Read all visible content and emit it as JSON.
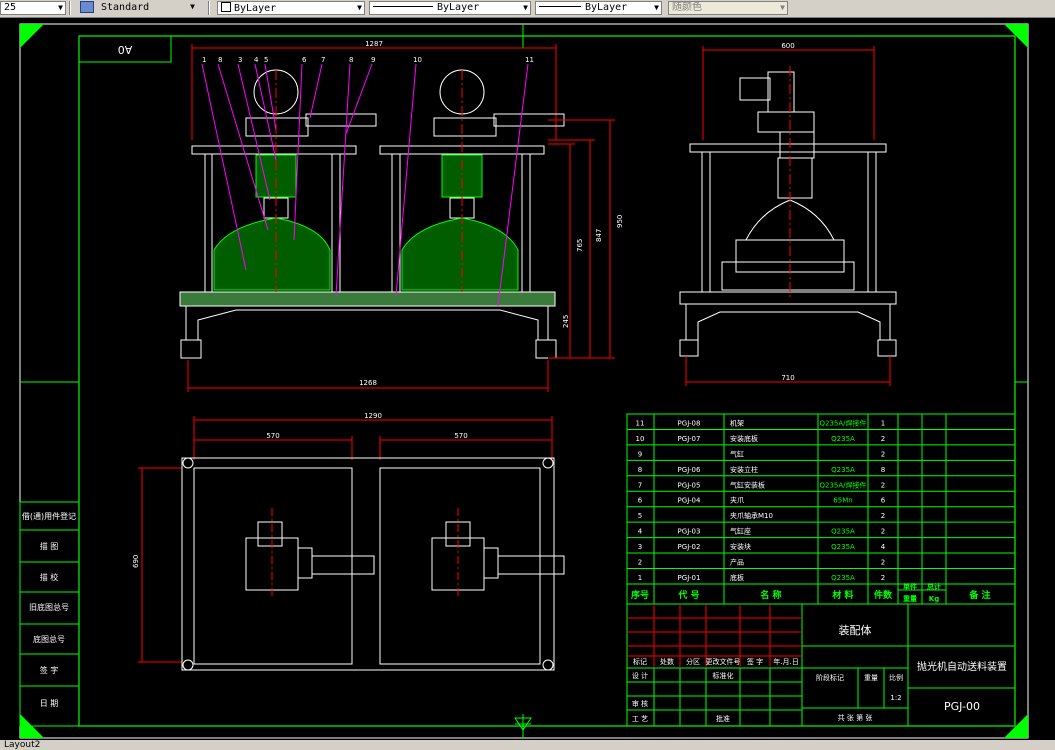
{
  "toolbar": {
    "size_value": "25",
    "text_style": "Standard",
    "layer_color": "ByLayer",
    "linetype": "ByLayer",
    "lineweight": "ByLayer",
    "plot_style": "随颜色"
  },
  "sheet": {
    "size_label": "A0",
    "overall_length": "1287"
  },
  "front_view": {
    "balloons": [
      "1",
      "8",
      "3",
      "4",
      "5",
      "6",
      "7",
      "8",
      "9",
      "10",
      "11"
    ],
    "dim_heights": [
      "765",
      "847",
      "950",
      "245"
    ],
    "dim_base_length": "1268"
  },
  "side_view": {
    "dim_top": "600",
    "dim_bottom": "710"
  },
  "plan_view": {
    "dim_total": "1290",
    "dim_left": "570",
    "dim_right": "570",
    "dim_depth": "690"
  },
  "left_margin": {
    "cells": [
      "借(通)用件登记",
      "描 图",
      "描 校",
      "旧底图总号",
      "底图总号",
      "签 字",
      "日 期"
    ]
  },
  "bom": {
    "header": [
      "序号",
      "代 号",
      "名 称",
      "材 料",
      "件数",
      "单件",
      "总计",
      "备 注"
    ],
    "header_sub": [
      "重量",
      "Kg"
    ],
    "rows": [
      {
        "no": "11",
        "code": "PGJ-08",
        "name": "机架",
        "material": "Q235A/焊接件",
        "qty": "1"
      },
      {
        "no": "10",
        "code": "PGJ-07",
        "name": "安装底板",
        "material": "Q235A",
        "qty": "2"
      },
      {
        "no": "9",
        "code": "",
        "name": "气缸",
        "material": "",
        "qty": "2"
      },
      {
        "no": "8",
        "code": "PGJ-06",
        "name": "安装立柱",
        "material": "Q235A",
        "qty": "8"
      },
      {
        "no": "7",
        "code": "PGJ-05",
        "name": "气缸安装板",
        "material": "Q235A/焊接件",
        "qty": "2"
      },
      {
        "no": "6",
        "code": "PGJ-04",
        "name": "夹爪",
        "material": "65Mn",
        "qty": "6"
      },
      {
        "no": "5",
        "code": "",
        "name": "夹爪轴承M10",
        "material": "",
        "qty": "2"
      },
      {
        "no": "4",
        "code": "PGJ-03",
        "name": "气缸座",
        "material": "Q235A",
        "qty": "2"
      },
      {
        "no": "3",
        "code": "PGJ-02",
        "name": "安装块",
        "material": "Q235A",
        "qty": "4"
      },
      {
        "no": "2",
        "code": "",
        "name": "产品",
        "material": "",
        "qty": "2"
      },
      {
        "no": "1",
        "code": "PGJ-01",
        "name": "底板",
        "material": "Q235A",
        "qty": "2"
      }
    ]
  },
  "title_block": {
    "assembly_label": "装配体",
    "product_name": "抛光机自动送料装置",
    "drawing_no": "PGJ-00",
    "scale": "1:2",
    "labels": {
      "mark": "标记",
      "count": "处数",
      "zone": "分区",
      "change_doc": "更改文件号",
      "sign": "签 字",
      "date": "年.月.日",
      "design": "设 计",
      "standardize": "标准化",
      "stage": "阶段标记",
      "weight": "重量",
      "ratio": "比例",
      "check": "审 核",
      "process": "工 艺",
      "approve": "批准",
      "sheets": "共  张  第  张"
    }
  },
  "status": {
    "layout_tab": "Layout2"
  }
}
